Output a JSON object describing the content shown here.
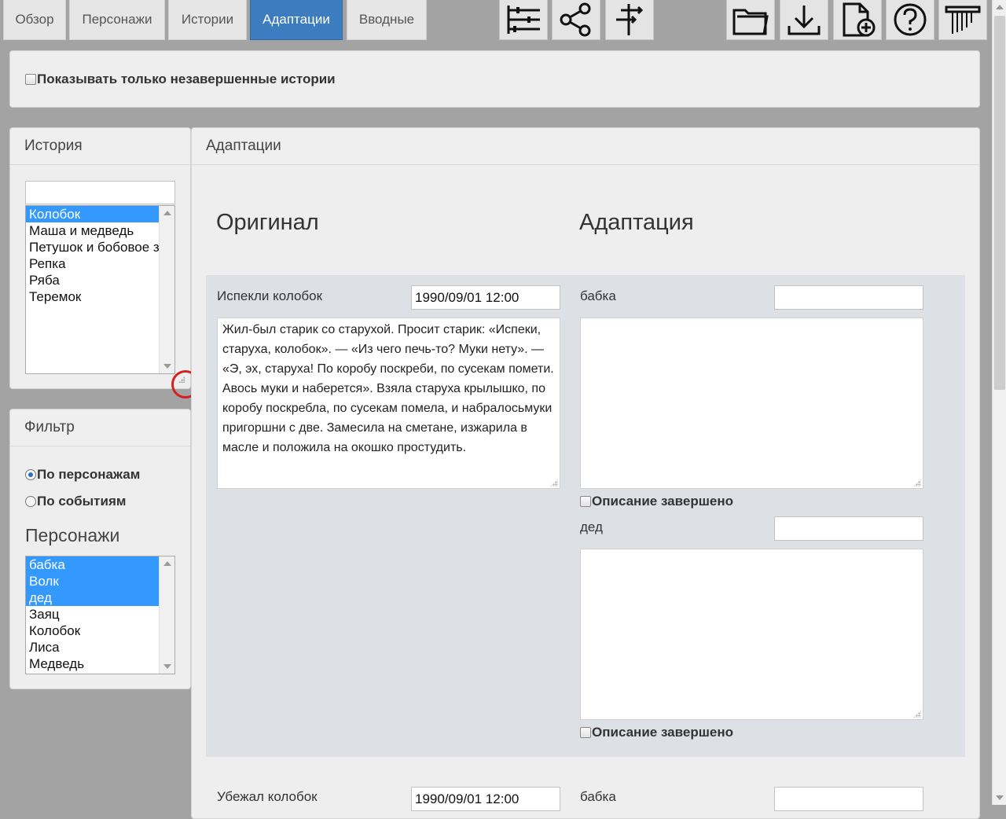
{
  "tabs": [
    {
      "label": "Обзор",
      "active": false
    },
    {
      "label": "Персонажи",
      "active": false
    },
    {
      "label": "Истории",
      "active": false
    },
    {
      "label": "Адаптации",
      "active": true
    },
    {
      "label": "Вводные",
      "active": false
    }
  ],
  "toolbar_icons": [
    "sliders-icon",
    "share-icon",
    "signpost-icon",
    "folder-open-icon",
    "download-icon",
    "new-file-icon",
    "help-icon",
    "column-icon"
  ],
  "filter_bar": {
    "show_unfinished_label": "Показывать только незавершенные истории",
    "checked": false
  },
  "history_panel": {
    "title": "История",
    "search_value": "",
    "items": [
      "Колобок",
      "Маша и медведь",
      "Петушок и бобовое зернышко",
      "Репка",
      "Ряба",
      "Теремок"
    ],
    "selected": "Колобок"
  },
  "filter_panel": {
    "title": "Фильтр",
    "radio_by_characters": "По персонажам",
    "radio_by_events": "По событиям",
    "selected_radio": "По персонажам",
    "characters_title": "Персонажи",
    "characters": [
      "бабка",
      "Волк",
      "дед",
      "Заяц",
      "Колобок",
      "Лиса",
      "Медведь"
    ],
    "selected_characters": [
      "бабка",
      "Волк",
      "дед"
    ]
  },
  "main_panel": {
    "title": "Адаптации",
    "original_heading": "Оригинал",
    "adaptation_heading": "Адаптация",
    "events": [
      {
        "name": "Испекли колобок",
        "time": "1990/09/01 12:00",
        "text": "Жил-был старик со старухой. Просит старик: «Испеки, старуха, колобок». — «Из чего печь-то? Муки нету». — «Э, эх, старуха! По коробу поскреби, по сусекам помети. Авось муки и наберется». Взяла старуха крылышко, по коробу поскребла, по сусекам помела, и набралосьмуки пригоршни с две. Замесила на сметане, изжарила в масле и положила на окошко простудить.",
        "adaptations": [
          {
            "character": "бабка",
            "name_value": "",
            "text": "",
            "done_label": "Описание завершено",
            "done": false
          },
          {
            "character": "дед",
            "name_value": "",
            "text": "",
            "done_label": "Описание завершено",
            "done": false
          }
        ]
      },
      {
        "name": "Убежал колобок",
        "time": "1990/09/01 12:00",
        "adaptations": [
          {
            "character": "бабка",
            "name_value": ""
          }
        ]
      }
    ]
  }
}
